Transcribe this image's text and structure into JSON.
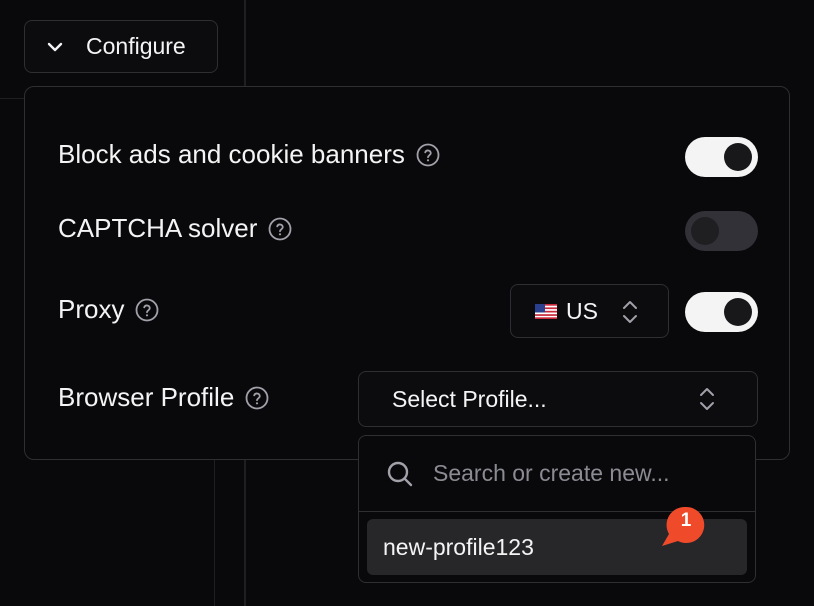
{
  "configure": {
    "label": "Configure",
    "icon": "chevron-down-icon"
  },
  "settings": {
    "block_ads": {
      "label": "Block ads and cookie banners",
      "enabled": true,
      "help_icon": "help-circle-icon"
    },
    "captcha": {
      "label": "CAPTCHA solver",
      "enabled": false,
      "disabled": true,
      "help_icon": "help-circle-icon"
    },
    "proxy": {
      "label": "Proxy",
      "enabled": true,
      "country_flag": "🇺🇸",
      "country": "US",
      "help_icon": "help-circle-icon"
    },
    "browser_profile": {
      "label": "Browser Profile",
      "selected": "Select Profile...",
      "help_icon": "help-circle-icon"
    }
  },
  "profile_dropdown": {
    "search_placeholder": "Search or create new...",
    "search_value": "",
    "options": [
      {
        "label": "new-profile123"
      }
    ]
  },
  "notification_badge": {
    "count": "1",
    "color": "#ef4b2b"
  },
  "colors": {
    "background": "#09090b",
    "border": "#2e2e33",
    "toggle_on": "#f4f4f5",
    "highlight": "#27272a"
  }
}
